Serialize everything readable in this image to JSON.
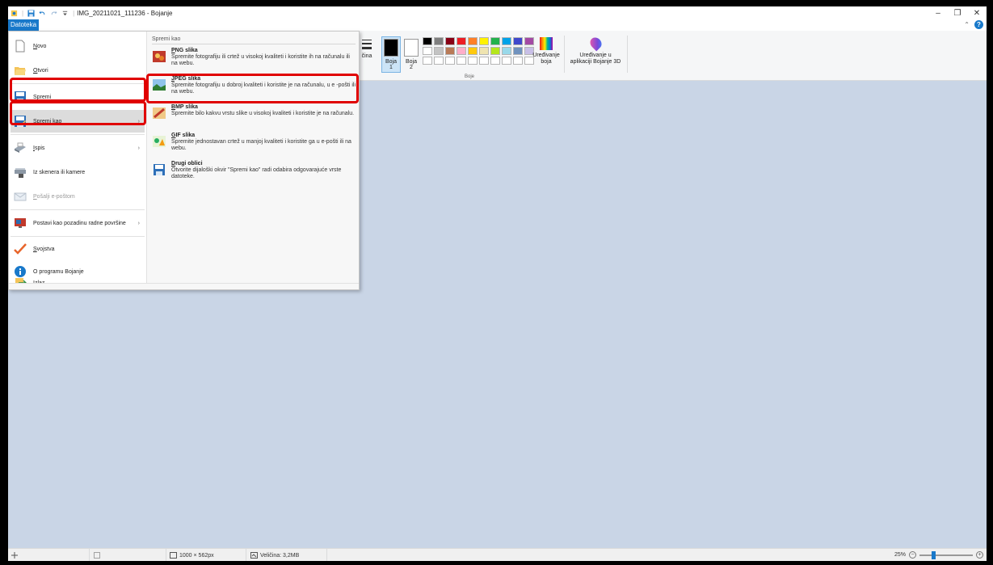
{
  "window": {
    "title": "IMG_20211021_111236 - Bojanje",
    "minimize": "–",
    "maximize": "❐",
    "close": "✕"
  },
  "ribbon": {
    "file_tab": "Datoteka",
    "collapse_glyph": "⌃",
    "help_glyph": "?",
    "partial_label": "čina",
    "color1_label": "Boja",
    "color1_num": "1",
    "color2_label": "Boja",
    "color2_num": "2",
    "edit_colors_line1": "Uređivanje",
    "edit_colors_line2": "boja",
    "paint3d_line1": "Uređivanje u",
    "paint3d_line2": "aplikaciji Bojanje 3D",
    "colors_group": "Boje",
    "color1_value": "#000000",
    "color2_value": "#ffffff",
    "palette_top": [
      "#000000",
      "#7f7f7f",
      "#880015",
      "#ed1c24",
      "#ff7f27",
      "#fff200",
      "#22b14c",
      "#00a2e8",
      "#3f48cc",
      "#a349a4"
    ],
    "palette_mid": [
      "#ffffff",
      "#c3c3c3",
      "#b97a57",
      "#ffaec9",
      "#ffc90e",
      "#efe4b0",
      "#b5e61d",
      "#99d9ea",
      "#7092be",
      "#c8bfe7"
    ],
    "palette_empty": [
      "#ffffff",
      "#ffffff",
      "#ffffff",
      "#ffffff",
      "#ffffff",
      "#ffffff",
      "#ffffff",
      "#ffffff",
      "#ffffff",
      "#ffffff"
    ]
  },
  "file_menu": {
    "items": [
      {
        "label": "Novo",
        "icon": "new-file-icon"
      },
      {
        "label": "Otvori",
        "icon": "open-folder-icon"
      },
      {
        "label": "Spremi",
        "icon": "save-icon"
      },
      {
        "label": "Spremi kao",
        "icon": "save-as-icon"
      },
      {
        "label": "Ispis",
        "icon": "print-icon"
      },
      {
        "label": "Iz skenera ili kamere",
        "icon": "scanner-icon"
      },
      {
        "label": "Pošalji e-poštom",
        "icon": "email-icon"
      },
      {
        "label": "Postavi kao pozadinu radne površine",
        "icon": "desktop-background-icon"
      },
      {
        "label": "Svojstva",
        "icon": "properties-check-icon"
      },
      {
        "label": "O programu Bojanje",
        "icon": "info-icon"
      },
      {
        "label": "Izlaz",
        "icon": "exit-icon"
      }
    ],
    "arrow": "›"
  },
  "save_as": {
    "header": "Spremi kao",
    "options": [
      {
        "title": "PNG slika",
        "desc": "Spremite fotografiju ili crtež u visokoj kvaliteti i koristite ih na računalu ili na webu."
      },
      {
        "title": "JPEG slika",
        "desc": "Spremite fotografiju u dobroj kvaliteti i koristite je na računalu, u e -pošti ili na webu."
      },
      {
        "title": "BMP slika",
        "desc": "Spremite bilo kakvu vrstu slike u visokoj kvaliteti i koristite je na računalu."
      },
      {
        "title": "GIF slika",
        "desc": "Spremite jednostavan crtež u manjoj kvaliteti i koristite ga u e-pošti ili na webu."
      },
      {
        "title": "Drugi oblici",
        "desc": "Otvorite dijaloški okvir \"Spremi kao\" radi odabira odgovarajuće vrste datoteke."
      }
    ]
  },
  "status": {
    "dimensions": "1000 × 562px",
    "size": "Veličina: 3,2MB",
    "zoom": "25%",
    "zoom_fraction": 0.25,
    "zoom_minus": "−",
    "zoom_plus": "+"
  },
  "colors": {
    "accent": "#1979ca",
    "highlight": "#e00000",
    "workspace": "#c9d5e6"
  }
}
